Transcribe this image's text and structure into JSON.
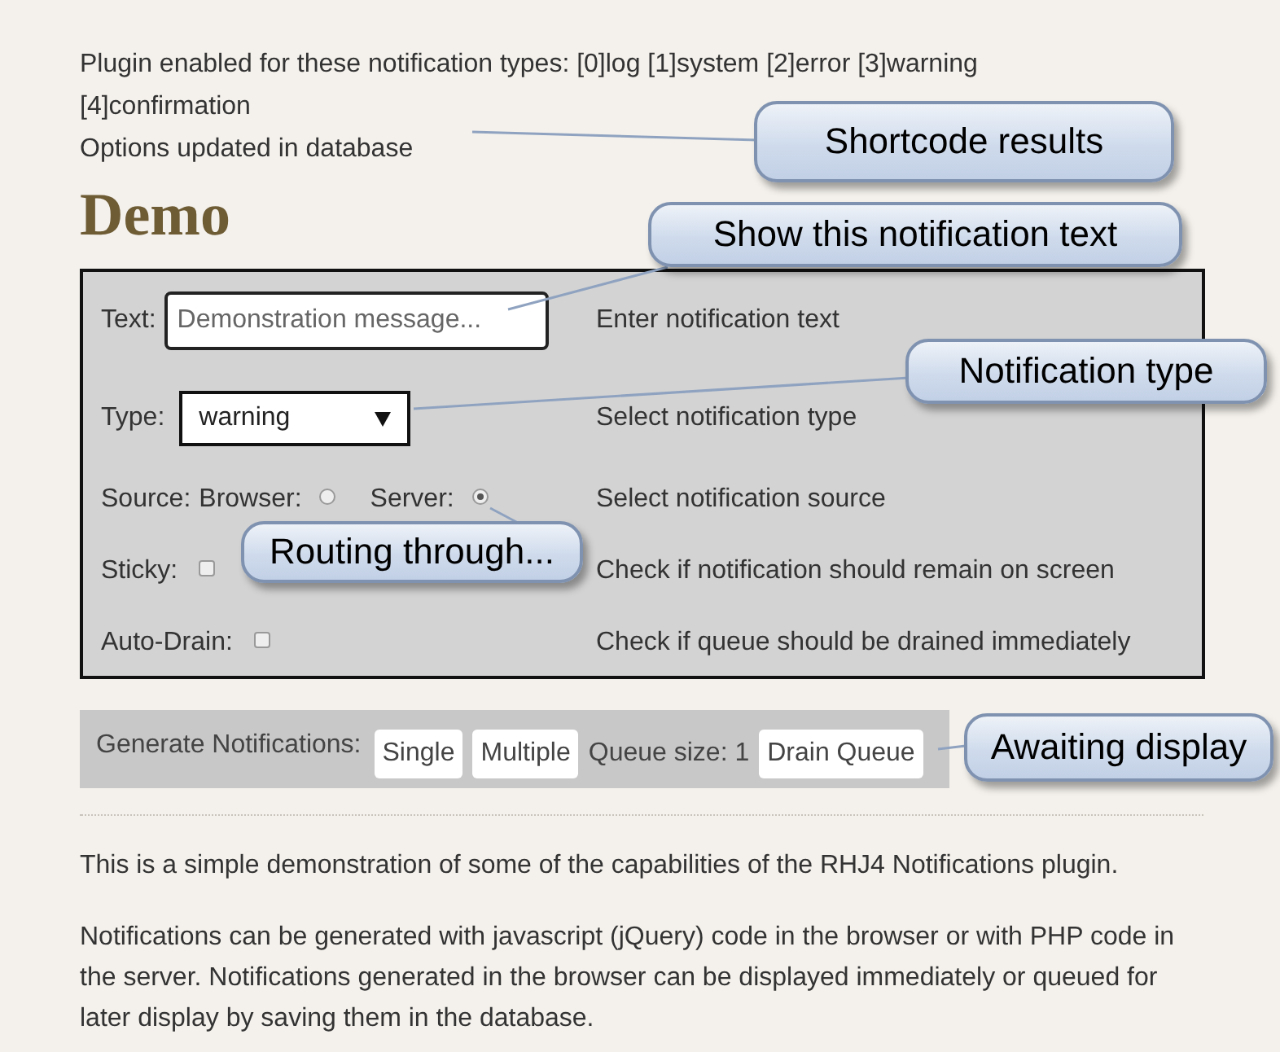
{
  "shortcode_results": [
    "Plugin enabled for these notification types: [0]log [1]system [2]error [3]warning [4]confirmation",
    "Options updated in database"
  ],
  "heading": "Demo",
  "form": {
    "rows": [
      {
        "kind": "text",
        "label": "Text:",
        "placeholder": "Demonstration message...",
        "hint": "Enter notification text"
      },
      {
        "kind": "select",
        "label": "Type:",
        "value": "warning",
        "hint": "Select notification type"
      },
      {
        "kind": "radio",
        "label": "Source:",
        "options": [
          {
            "label": "Browser:",
            "selected": false
          },
          {
            "label": "Server:",
            "selected": true
          }
        ],
        "hint": "Select notification source"
      },
      {
        "kind": "checkbox",
        "label": "Sticky:",
        "checked": false,
        "hint": "Check if notification should remain on screen"
      },
      {
        "kind": "checkbox",
        "label": "Auto-Drain:",
        "checked": false,
        "hint": "Check if queue should be drained immediately"
      }
    ]
  },
  "generate_bar": {
    "label": "Generate Notifications:",
    "items": [
      {
        "kind": "button",
        "text": "Single"
      },
      {
        "kind": "button",
        "text": "Multiple"
      },
      {
        "kind": "text",
        "text": "Queue size: 1"
      },
      {
        "kind": "button",
        "text": "Drain Queue"
      }
    ]
  },
  "description": [
    "This is a simple demonstration of some of the capabilities of the RHJ4 Notifications plugin.",
    "Notifications can be generated with javascript (jQuery) code in the browser or with PHP code in the server. Notifications generated in the browser can be displayed immediately or queued for later display by saving them in the database."
  ],
  "callouts": [
    {
      "text": "Shortcode results"
    },
    {
      "text": "Show this notification text"
    },
    {
      "text": "Notification type"
    },
    {
      "text": "Routing through..."
    },
    {
      "text": "Awaiting display"
    }
  ]
}
